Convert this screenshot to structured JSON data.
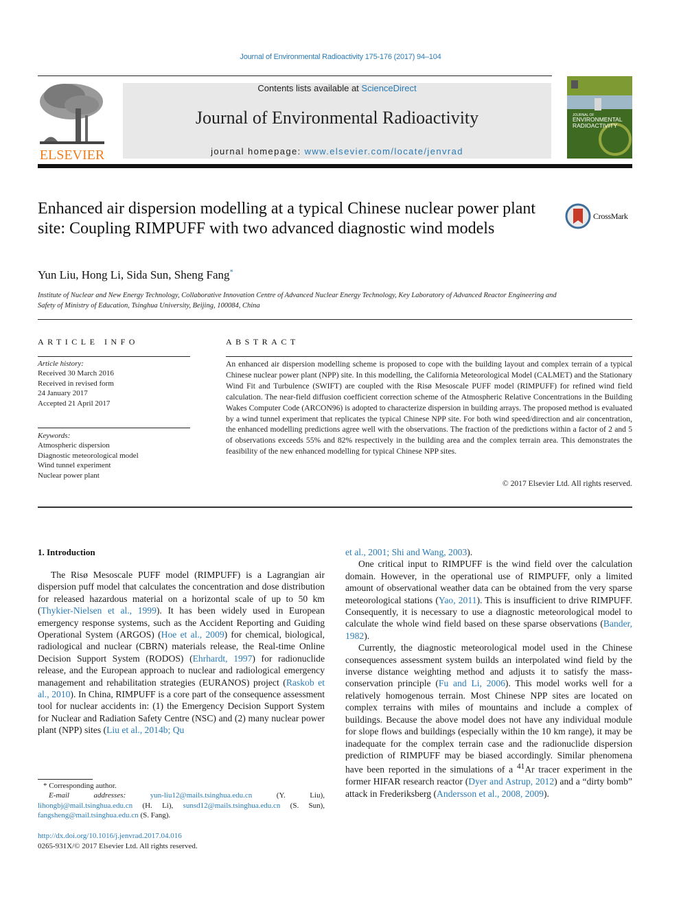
{
  "journal_ref": "Journal of Environmental Radioactivity 175-176 (2017) 94–104",
  "masthead": {
    "publisher": "ELSEVIER",
    "contents_prefix": "Contents lists available at ",
    "contents_link": "ScienceDirect",
    "journal_title": "Journal of Environmental Radioactivity",
    "homepage_prefix": "journal homepage: ",
    "homepage_link": "www.elsevier.com/locate/jenvrad",
    "cover_title_small": "JOURNAL OF",
    "cover_title_line1": "ENVIRONMENTAL",
    "cover_title_line2": "RADIOACTIVITY",
    "colors": {
      "link": "#2a7bb5",
      "publisher": "#f07d1a",
      "banner": "#e8e8e8",
      "cover": "#6f8a2a"
    }
  },
  "article": {
    "title": "Enhanced air dispersion modelling at a typical Chinese nuclear power plant site: Coupling RIMPUFF with two advanced diagnostic wind models",
    "crossmark_label": "CrossMark",
    "authors": "Yun Liu, Hong Li, Sida Sun, Sheng Fang",
    "corresponding_mark": "*",
    "affiliation": "Institute of Nuclear and New Energy Technology, Collaborative Innovation Centre of Advanced Nuclear Energy Technology, Key Laboratory of Advanced Reactor Engineering and Safety of Ministry of Education, Tsinghua University, Beijing, 100084, China"
  },
  "article_info": {
    "label": "ARTICLE INFO",
    "history_label": "Article history:",
    "history": [
      "Received 30 March 2016",
      "Received in revised form",
      "24 January 2017",
      "Accepted 21 April 2017"
    ],
    "keywords_label": "Keywords:",
    "keywords": [
      "Atmospheric dispersion",
      "Diagnostic meteorological model",
      "Wind tunnel experiment",
      "Nuclear power plant"
    ]
  },
  "abstract": {
    "label": "ABSTRACT",
    "text": "An enhanced air dispersion modelling scheme is proposed to cope with the building layout and complex terrain of a typical Chinese nuclear power plant (NPP) site. In this modelling, the California Meteorological Model (CALMET) and the Stationary Wind Fit and Turbulence (SWIFT) are coupled with the Risø Mesoscale PUFF model (RIMPUFF) for refined wind field calculation. The near-field diffusion coefficient correction scheme of the Atmospheric Relative Concentrations in the Building Wakes Computer Code (ARCON96) is adopted to characterize dispersion in building arrays. The proposed method is evaluated by a wind tunnel experiment that replicates the typical Chinese NPP site. For both wind speed/direction and air concentration, the enhanced modelling predictions agree well with the observations. The fraction of the predictions within a factor of 2 and 5 of observations exceeds 55% and 82% respectively in the building area and the complex terrain area. This demonstrates the feasibility of the new enhanced modelling for typical Chinese NPP sites.",
    "copyright": "© 2017 Elsevier Ltd. All rights reserved."
  },
  "intro": {
    "heading": "1.  Introduction",
    "left": [
      {
        "t": "The Risø Mesoscale PUFF model (RIMPUFF) is a Lagrangian air dispersion puff model that calculates the concentration and dose distribution for released hazardous material on a horizontal scale of up to 50 km ("
      },
      {
        "l": "Thykier-Nielsen et al., 1999"
      },
      {
        "t": "). It has been widely used in European emergency response systems, such as the Accident Reporting and Guiding Operational System (ARGOS) ("
      },
      {
        "l": "Hoe et al., 2009"
      },
      {
        "t": ") for chemical, biological, radiological and nuclear (CBRN) materials release, the Real-time Online Decision Support System (RODOS) ("
      },
      {
        "l": "Ehrhardt, 1997"
      },
      {
        "t": ") for radionuclide release, and the European approach to nuclear and radiological emergency management and rehabilitation strategies (EURANOS) project ("
      },
      {
        "l": "Raskob et al., 2010"
      },
      {
        "t": "). In China, RIMPUFF is a core part of the consequence assessment tool for nuclear accidents in: (1) the Emergency Decision Support System for Nuclear and Radiation Safety Centre (NSC) and (2) many nuclear power plant (NPP) sites ("
      },
      {
        "l": "Liu et al., 2014b; Qu"
      }
    ],
    "right_p1": [
      {
        "l": "et al., 2001; Shi and Wang, 2003"
      },
      {
        "t": ")."
      }
    ],
    "right_p2": [
      {
        "t": "One critical input to RIMPUFF is the wind field over the calculation domain. However, in the operational use of RIMPUFF, only a limited amount of observational weather data can be obtained from the very sparse meteorological stations ("
      },
      {
        "l": "Yao, 2011"
      },
      {
        "t": "). This is insufficient to drive RIMPUFF. Consequently, it is necessary to use a diagnostic meteorological model to calculate the whole wind field based on these sparse observations ("
      },
      {
        "l": "Bander, 1982"
      },
      {
        "t": ")."
      }
    ],
    "right_p3": [
      {
        "t": "Currently, the diagnostic meteorological model used in the Chinese consequences assessment system builds an interpolated wind field by the inverse distance weighting method and adjusts it to satisfy the mass-conservation principle ("
      },
      {
        "l": "Fu and Li, 2006"
      },
      {
        "t": "). This model works well for a relatively homogenous terrain. Most Chinese NPP sites are located on complex terrains with miles of mountains and include a complex of buildings. Because the above model does not have any individual module for slope flows and buildings (especially within the 10 km range), it may be inadequate for the complex terrain case and the radionuclide dispersion prediction of RIMPUFF may be biased accordingly. Similar phenomena have been reported in the simulations of a "
      },
      {
        "sup": "41"
      },
      {
        "t": "Ar tracer experiment in the former HIFAR research reactor ("
      },
      {
        "l": "Dyer and Astrup, 2012"
      },
      {
        "t": ") and a “dirty bomb” attack in Frederiksberg ("
      },
      {
        "l": "Andersson et al., 2008, 2009"
      },
      {
        "t": ")."
      }
    ]
  },
  "footnotes": {
    "corresponding": "* Corresponding author.",
    "email_label": "E-mail addresses: ",
    "emails": [
      {
        "addr": "yun-liu12@mails.tsinghua.edu.cn",
        "name": " (Y. Liu), "
      },
      {
        "addr": "lihongbj@mail.tsinghua.edu.cn",
        "name": " (H. Li), "
      },
      {
        "addr": "sunsd12@mails.tsinghua.edu.cn",
        "name": " (S. Sun), "
      },
      {
        "addr": "fangsheng@mail.tsinghua.edu.cn",
        "name": " (S. Fang)."
      }
    ],
    "doi": "http://dx.doi.org/10.1016/j.jenvrad.2017.04.016",
    "issn": "0265-931X/© 2017 Elsevier Ltd. All rights reserved."
  }
}
